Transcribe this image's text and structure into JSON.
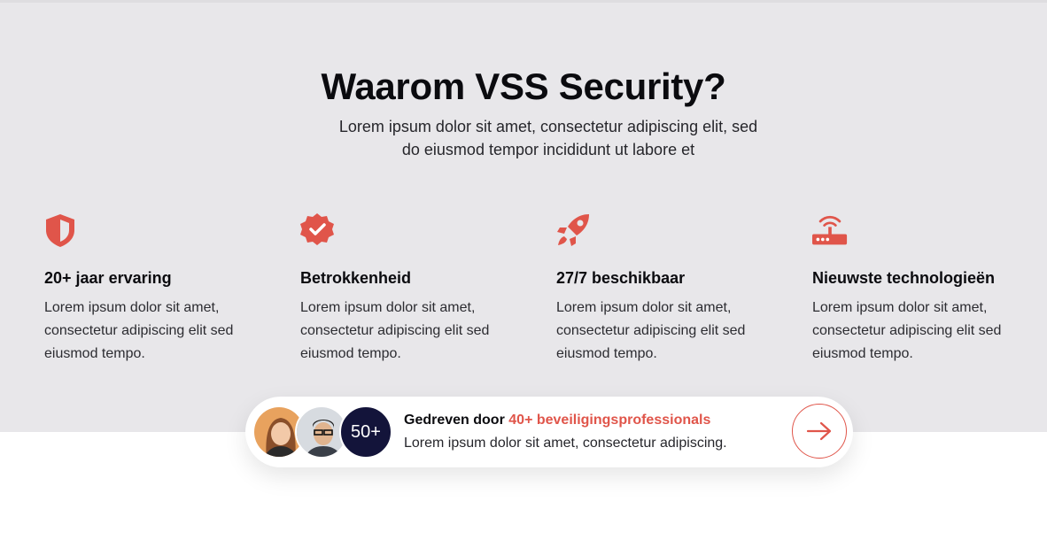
{
  "section": {
    "title": "Waarom VSS Security?",
    "subtitle_line1": "Lorem ipsum dolor sit amet, consectetur adipiscing elit, sed",
    "subtitle_line2": "do eiusmod tempor incididunt ut labore et"
  },
  "features": [
    {
      "icon": "shield-icon",
      "title": "20+ jaar ervaring",
      "desc_lines": [
        "Lorem ipsum dolor sit amet,",
        "consectetur adipiscing elit sed",
        "eiusmod tempo."
      ]
    },
    {
      "icon": "verified-badge-icon",
      "title": "Betrokkenheid",
      "desc_lines": [
        "Lorem ipsum dolor sit amet,",
        "consectetur adipiscing elit sed",
        "eiusmod tempo."
      ]
    },
    {
      "icon": "rocket-icon",
      "title": "27/7 beschikbaar",
      "desc_lines": [
        "Lorem ipsum dolor sit amet,",
        "consectetur adipiscing elit sed",
        "eiusmod tempo."
      ]
    },
    {
      "icon": "router-icon",
      "title": "Nieuwste technologieën",
      "desc_lines": [
        "Lorem ipsum dolor sit amet,",
        "consectetur adipiscing elit sed",
        "eiusmod tempo."
      ]
    }
  ],
  "cta": {
    "lead_text": "Gedreven door",
    "highlight_text": "40+ beveiligingsprofessionals",
    "description": "Lorem ipsum dolor sit amet, consectetur adipiscing.",
    "count_badge": "50+",
    "arrow_icon": "arrow-right-icon"
  },
  "colors": {
    "accent": "#e0554a",
    "band_background": "#e8e7ea",
    "badge_background": "#13143a",
    "text": "#0b0b0f"
  }
}
